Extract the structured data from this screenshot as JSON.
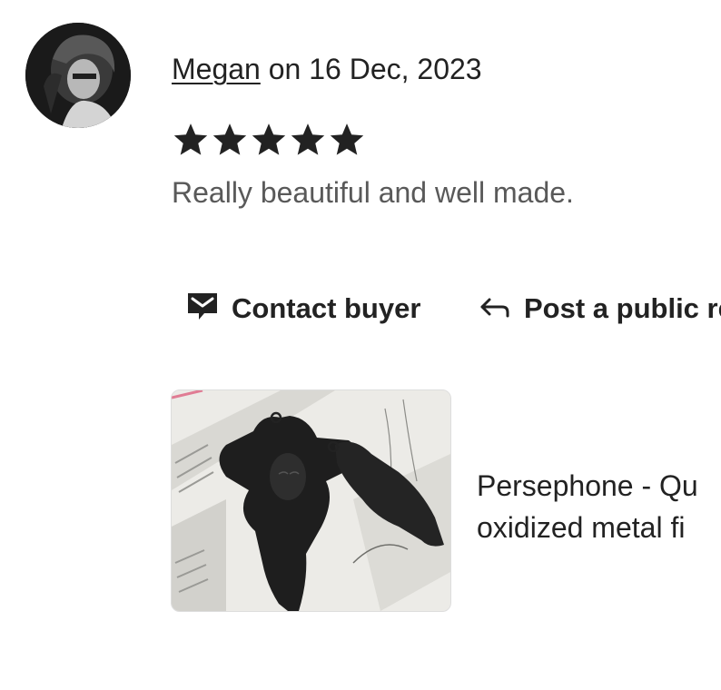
{
  "review": {
    "reviewer_name": "Megan",
    "date_text": " on 16 Dec, 2023",
    "rating": 5,
    "rating_max": 5,
    "text": "Really beautiful and well made."
  },
  "actions": {
    "contact_label": "Contact buyer",
    "reply_label": "Post a public re"
  },
  "listing": {
    "title_line1": "Persephone - Qu",
    "title_line2": "oxidized metal fi"
  },
  "icons": {
    "contact": "message-icon",
    "reply": "reply-arrow-icon",
    "star": "star-icon"
  },
  "colors": {
    "text_primary": "#222222",
    "text_secondary": "#595959"
  }
}
